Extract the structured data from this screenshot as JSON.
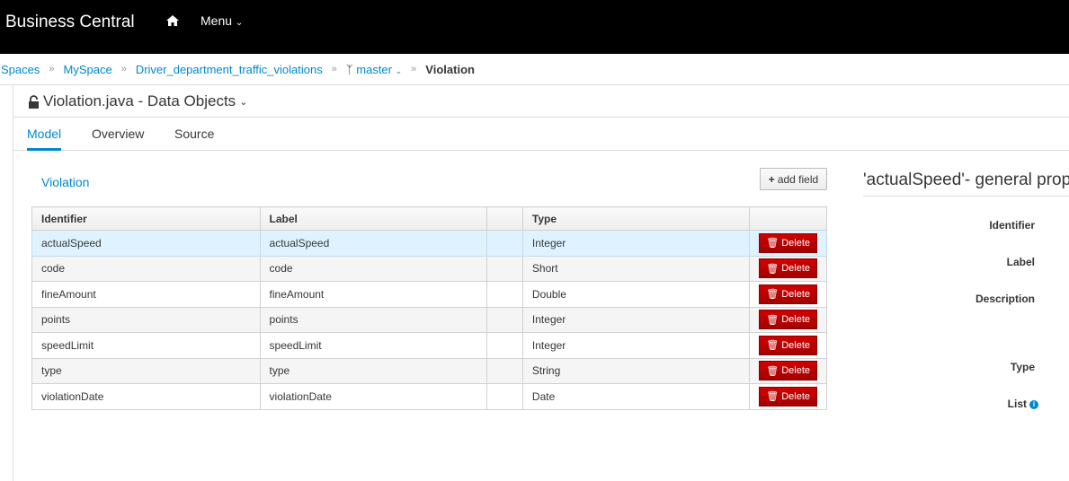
{
  "header": {
    "brand": "Business Central",
    "menu": "Menu"
  },
  "breadcrumb": {
    "items": [
      "Spaces",
      "MySpace",
      "Driver_department_traffic_violations"
    ],
    "branch": "master",
    "current": "Violation"
  },
  "editor": {
    "title": "Violation.java - Data Objects",
    "tabs": [
      "Model",
      "Overview",
      "Source"
    ]
  },
  "model": {
    "object_name": "Violation",
    "add_field": "add field",
    "columns": [
      "Identifier",
      "Label",
      "",
      "Type",
      ""
    ],
    "delete_label": "Delete",
    "rows": [
      {
        "id": "actualSpeed",
        "label": "actualSpeed",
        "type": "Integer"
      },
      {
        "id": "code",
        "label": "code",
        "type": "Short"
      },
      {
        "id": "fineAmount",
        "label": "fineAmount",
        "type": "Double"
      },
      {
        "id": "points",
        "label": "points",
        "type": "Integer"
      },
      {
        "id": "speedLimit",
        "label": "speedLimit",
        "type": "Integer"
      },
      {
        "id": "type",
        "label": "type",
        "type": "String"
      },
      {
        "id": "violationDate",
        "label": "violationDate",
        "type": "Date"
      }
    ]
  },
  "properties": {
    "title": "'actualSpeed'- general properties",
    "labels": [
      "Identifier",
      "Label",
      "Description",
      "Type",
      "List"
    ]
  }
}
